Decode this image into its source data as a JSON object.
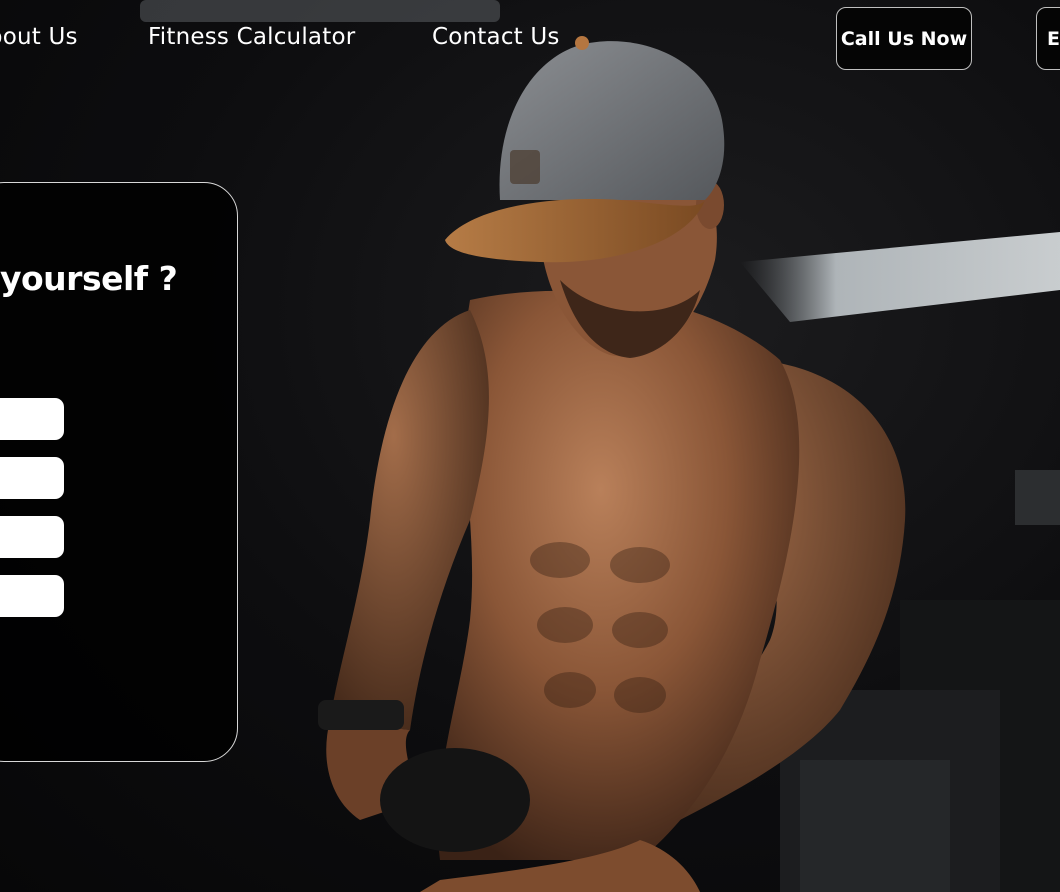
{
  "nav": {
    "links": [
      "About Us",
      "Fitness Calculator",
      "Contact Us"
    ],
    "call_button": "Call Us Now",
    "second_button": "E"
  },
  "form": {
    "title": "yourself ?",
    "fields": [
      {
        "value": "",
        "placeholder": ""
      },
      {
        "value": "",
        "placeholder": ""
      },
      {
        "value": "",
        "placeholder": ""
      },
      {
        "value": "",
        "placeholder": ""
      }
    ]
  },
  "hero": {
    "image": "man-in-gray-cap-lifting-weight-photo"
  },
  "colors": {
    "background": "#0b0b0b",
    "text": "#ffffff",
    "card_border": "#d8d8d8",
    "button_border": "#bfbfbf"
  }
}
